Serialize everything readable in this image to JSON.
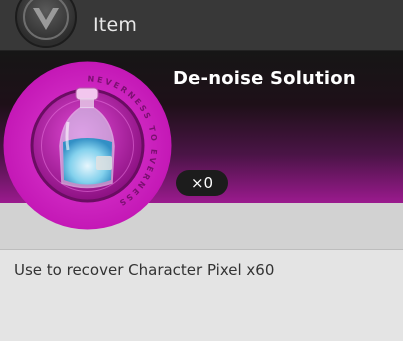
{
  "header": {
    "title": "Item",
    "logo_icon": "v-shield-logo-icon"
  },
  "item": {
    "name": "De-noise Solution",
    "quantity": "×0",
    "description": "Use to recover Character Pixel x60",
    "emblem_text": "NEVERNESS TO EVERNESS",
    "icon": "potion-bottle-icon"
  },
  "colors": {
    "accent": "#c21cb2",
    "header_bg": "#383838",
    "panel_bg": "#d2d2d2"
  }
}
